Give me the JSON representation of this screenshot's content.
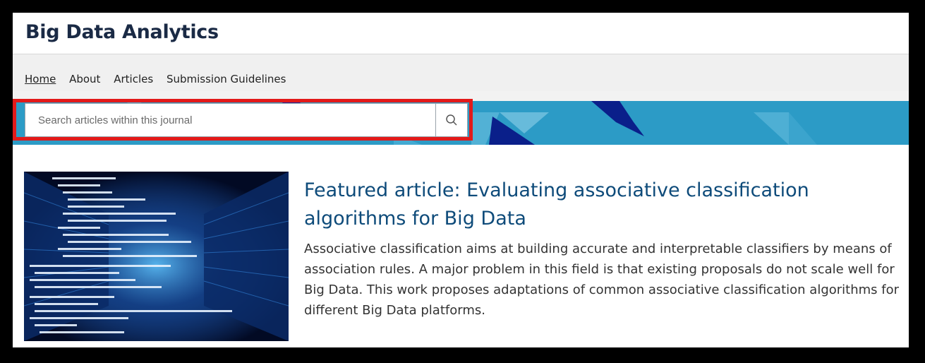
{
  "header": {
    "title": "Big Data Analytics"
  },
  "nav": {
    "items": [
      {
        "label": "Home",
        "active": true
      },
      {
        "label": "About",
        "active": false
      },
      {
        "label": "Articles",
        "active": false
      },
      {
        "label": "Submission Guidelines",
        "active": false
      }
    ]
  },
  "search": {
    "placeholder": "Search articles within this journal",
    "value": "",
    "icon": "search-icon"
  },
  "featured": {
    "title": "Featured article: Evaluating associative classification algorithms for Big Data",
    "abstract": "Associative classification aims at building accurate and interpretable classifiers by means of association rules. A major problem in this field is that existing proposals do not scale well for Big Data. This work proposes adaptations of common associative classification algorithms for different Big Data platforms.",
    "image": "server-room-code-image"
  },
  "colors": {
    "brand": "#1a2a45",
    "accent": "#2c9bc6",
    "title": "#0e4b7a",
    "highlight": "#e21a1a"
  }
}
